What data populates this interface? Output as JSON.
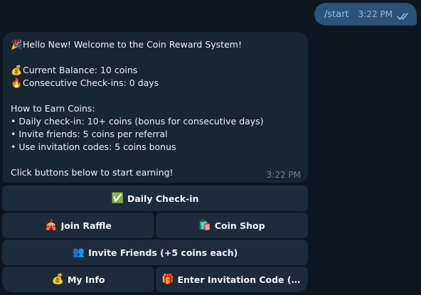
{
  "outgoing": {
    "text": "/start",
    "time": "3:22 PM"
  },
  "incoming": {
    "lines": [
      {
        "icon": "🎉",
        "icon_name": "party-popper-icon",
        "text": "Hello New! Welcome to the Coin Reward System!"
      },
      {
        "icon": "",
        "text": ""
      },
      {
        "icon": "💰",
        "icon_name": "money-bag-icon",
        "text": "Current Balance: 10 coins"
      },
      {
        "icon": "🔥",
        "icon_name": "fire-icon",
        "text": "Consecutive Check-ins: 0 days"
      },
      {
        "icon": "",
        "text": ""
      },
      {
        "icon": "",
        "text": "How to Earn Coins:"
      },
      {
        "icon": "",
        "text": "• Daily check-in: 10+ coins (bonus for consecutive days)"
      },
      {
        "icon": "",
        "text": "• Invite friends: 5 coins per referral"
      },
      {
        "icon": "",
        "text": "• Use invitation codes: 5 coins bonus"
      },
      {
        "icon": "",
        "text": ""
      },
      {
        "icon": "",
        "text": "Click buttons below to start earning!"
      }
    ],
    "time": "3:22 PM"
  },
  "keyboard": {
    "daily_checkin": {
      "icon": "✅",
      "icon_name": "check-mark-icon",
      "label": "Daily Check-in"
    },
    "join_raffle": {
      "icon": "🎪",
      "icon_name": "circus-tent-icon",
      "label": "Join Raffle"
    },
    "coin_shop": {
      "icon": "🛍️",
      "icon_name": "shopping-bags-icon",
      "label": "Coin Shop"
    },
    "invite_friends": {
      "icon": "👥",
      "icon_name": "people-icon",
      "label": "Invite Friends (+5 coins each)"
    },
    "my_info": {
      "icon": "💰",
      "icon_name": "money-bag-icon",
      "label": "My Info"
    },
    "enter_code": {
      "icon": "🎁",
      "icon_name": "gift-icon",
      "label": "Enter Invitation Code (+5 ..."
    }
  },
  "colors": {
    "background": "#0e1621",
    "outgoing_bubble": "#2b5278",
    "incoming_bubble": "#182533",
    "keyboard_button": "#1d2b3b"
  }
}
